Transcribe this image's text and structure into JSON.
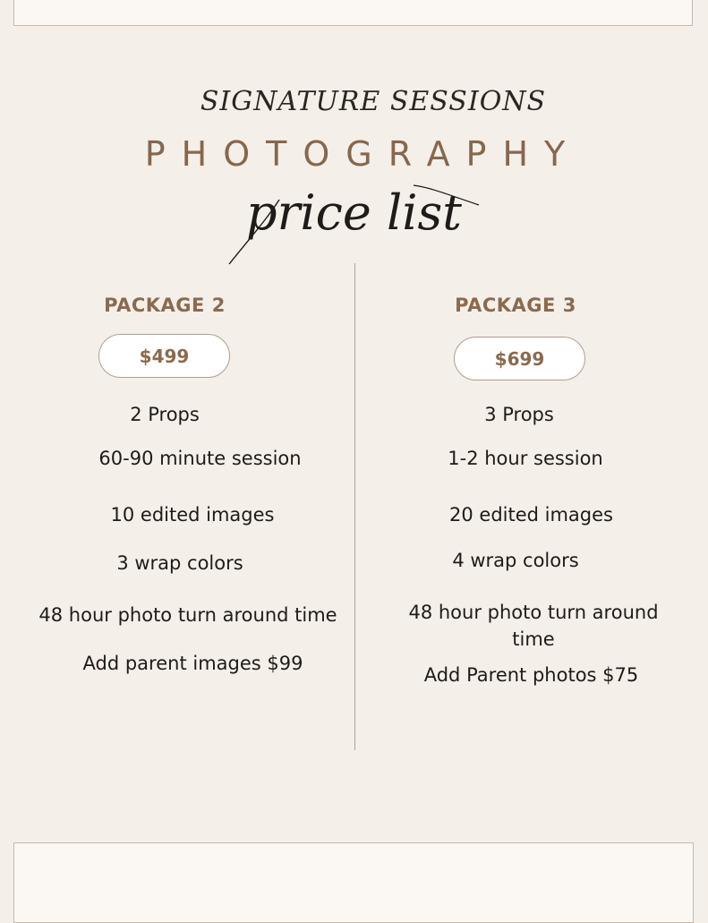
{
  "header": {
    "script_title": "SIGNATURE SESSIONS",
    "title": "PHOTOGRAPHY",
    "script_subtitle": "price list"
  },
  "packages": [
    {
      "name": "PACKAGE 2",
      "price": "$499",
      "features": [
        "2 Props",
        "60-90 minute session",
        "10 edited images",
        "3 wrap colors",
        "48 hour photo turn around time",
        "Add parent images $99"
      ]
    },
    {
      "name": "PACKAGE 3",
      "price": "$699",
      "features": [
        "3 Props",
        "1-2 hour session",
        "20 edited images",
        "4 wrap colors",
        "48 hour photo turn around",
        "time",
        "Add Parent photos $75"
      ]
    }
  ],
  "colors": {
    "background": "#f4efe9",
    "accent": "#86674d",
    "text": "#1e1b18",
    "frame": "#c8b8ab"
  }
}
